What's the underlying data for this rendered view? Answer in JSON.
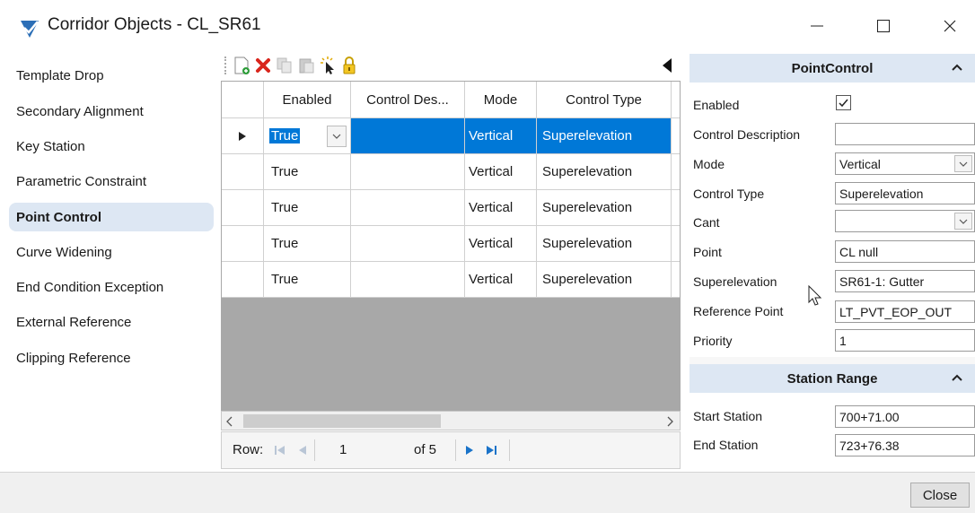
{
  "window": {
    "title": "Corridor Objects - CL_SR61"
  },
  "nav": {
    "items": [
      {
        "label": "Template Drop"
      },
      {
        "label": "Secondary Alignment"
      },
      {
        "label": "Key Station"
      },
      {
        "label": "Parametric Constraint"
      },
      {
        "label": "Point Control",
        "selected": true
      },
      {
        "label": "Curve Widening"
      },
      {
        "label": "End Condition Exception"
      },
      {
        "label": "External Reference"
      },
      {
        "label": "Clipping Reference"
      }
    ]
  },
  "grid": {
    "columns": [
      "Enabled",
      "Control Des...",
      "Mode",
      "Control Type"
    ],
    "rows": [
      {
        "enabled": "True",
        "control_description": "",
        "mode": "Vertical",
        "control_type": "Superelevation"
      },
      {
        "enabled": "True",
        "control_description": "",
        "mode": "Vertical",
        "control_type": "Superelevation"
      },
      {
        "enabled": "True",
        "control_description": "",
        "mode": "Vertical",
        "control_type": "Superelevation"
      },
      {
        "enabled": "True",
        "control_description": "",
        "mode": "Vertical",
        "control_type": "Superelevation"
      },
      {
        "enabled": "True",
        "control_description": "",
        "mode": "Vertical",
        "control_type": "Superelevation"
      }
    ],
    "selected_row": 0
  },
  "navigator": {
    "row_label": "Row:",
    "current": "1",
    "of_label": "of 5"
  },
  "point_control": {
    "header": "PointControl",
    "enabled_label": "Enabled",
    "enabled_checked": true,
    "control_description_label": "Control Description",
    "control_description_value": "",
    "mode_label": "Mode",
    "mode_value": "Vertical",
    "control_type_label": "Control Type",
    "control_type_value": "Superelevation",
    "cant_label": "Cant",
    "cant_value": "",
    "point_label": "Point",
    "point_value": "CL null",
    "superelevation_label": "Superelevation",
    "superelevation_value": "SR61-1: Gutter",
    "reference_point_label": "Reference Point",
    "reference_point_value": "LT_PVT_EOP_OUT",
    "priority_label": "Priority",
    "priority_value": "1"
  },
  "station_range": {
    "header": "Station Range",
    "start_label": "Start Station",
    "start_value": "700+71.00",
    "end_label": "End Station",
    "end_value": "723+76.38"
  },
  "footer": {
    "close_label": "Close"
  },
  "colors": {
    "selection": "#0078d7",
    "section_header": "#dde7f3",
    "delete_icon": "#d9251c",
    "nav_arrow": "#1a73c9"
  }
}
